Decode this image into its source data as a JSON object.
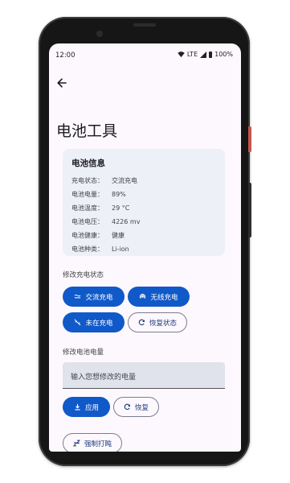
{
  "status_bar": {
    "time": "12:00",
    "network": "LTE",
    "battery": "100%"
  },
  "page": {
    "title": "电池工具"
  },
  "battery_info": {
    "title": "电池信息",
    "rows": [
      {
        "label": "充电状态：",
        "value": "交流充电"
      },
      {
        "label": "电池电量：",
        "value": "89%"
      },
      {
        "label": "电池温度：",
        "value": "29 °C"
      },
      {
        "label": "电池电压：",
        "value": "4226 mv"
      },
      {
        "label": "电池健康：",
        "value": "健康"
      },
      {
        "label": "电池种类：",
        "value": "Li-ion"
      }
    ]
  },
  "charge_state": {
    "label": "修改充电状态",
    "ac": "交流充电",
    "wireless": "无线充电",
    "not_charging": "未在充电",
    "restore": "恢复状态"
  },
  "battery_level": {
    "label": "修改电池电量",
    "placeholder": "输入您想修改的电量",
    "apply": "应用",
    "restore": "恢复"
  },
  "extra": {
    "force_doze": "强制打盹"
  },
  "colors": {
    "primary": "#1059c9",
    "background": "#fdf8fd",
    "card": "#eef0f8"
  }
}
